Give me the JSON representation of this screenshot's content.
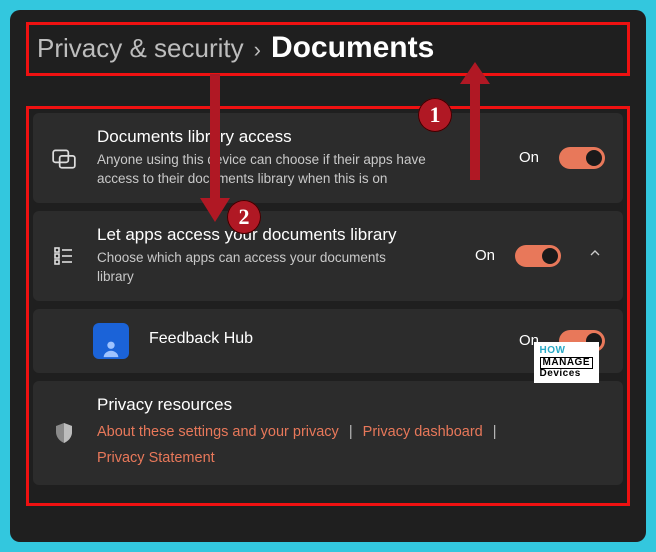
{
  "breadcrumb": {
    "parent": "Privacy & security",
    "separator": "›",
    "current": "Documents"
  },
  "cards": {
    "library": {
      "title": "Documents library access",
      "subtitle": "Anyone using this device can choose if their apps have access to their documents library when this is on",
      "state": "On"
    },
    "apps": {
      "title": "Let apps access your documents library",
      "subtitle": "Choose which apps can access your documents library",
      "state": "On"
    },
    "feedback": {
      "title": "Feedback Hub",
      "state": "On"
    },
    "resources": {
      "title": "Privacy resources",
      "link1": "About these settings and your privacy",
      "link2": "Privacy dashboard",
      "link3": "Privacy Statement"
    }
  },
  "annotations": {
    "one": "1",
    "two": "2"
  },
  "logo": {
    "row1": "HOW",
    "row2": "MANAGE",
    "row3": "Devices"
  }
}
